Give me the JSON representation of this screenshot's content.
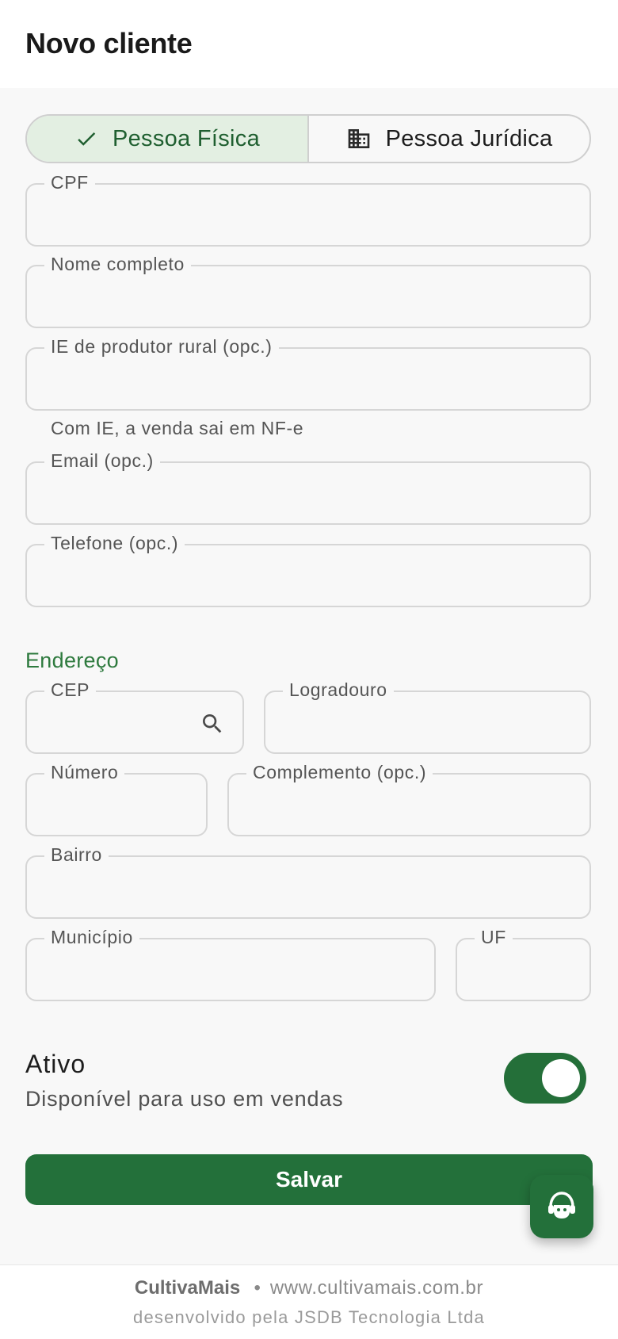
{
  "header": {
    "title": "Novo cliente"
  },
  "person_type": {
    "options": [
      {
        "label": "Pessoa Física",
        "icon": "check-icon",
        "selected": true
      },
      {
        "label": "Pessoa Jurídica",
        "icon": "building-icon",
        "selected": false
      }
    ]
  },
  "fields": {
    "cpf": {
      "label": "CPF",
      "value": ""
    },
    "nome": {
      "label": "Nome completo",
      "value": ""
    },
    "ie": {
      "label": "IE de produtor rural (opc.)",
      "value": "",
      "helper": "Com IE, a venda sai em NF-e"
    },
    "email": {
      "label": "Email (opc.)",
      "value": ""
    },
    "telefone": {
      "label": "Telefone (opc.)",
      "value": ""
    }
  },
  "address": {
    "section_title": "Endereço",
    "cep": {
      "label": "CEP",
      "value": "",
      "icon": "search-icon"
    },
    "logradouro": {
      "label": "Logradouro",
      "value": ""
    },
    "numero": {
      "label": "Número",
      "value": ""
    },
    "complemento": {
      "label": "Complemento (opc.)",
      "value": ""
    },
    "bairro": {
      "label": "Bairro",
      "value": ""
    },
    "municipio": {
      "label": "Município",
      "value": ""
    },
    "uf": {
      "label": "UF",
      "value": ""
    }
  },
  "active": {
    "title": "Ativo",
    "subtitle": "Disponível para uso em vendas",
    "on": true
  },
  "actions": {
    "save_label": "Salvar",
    "support_icon": "support-agent-icon"
  },
  "footer": {
    "brand": "CultivaMais",
    "separator": "•",
    "site": "www.cultivamais.com.br",
    "developer": "desenvolvido pela JSDB Tecnologia Ltda"
  },
  "colors": {
    "primary": "#23703a",
    "selected_bg": "#e3efe2",
    "accent_text": "#2e7a3e"
  }
}
